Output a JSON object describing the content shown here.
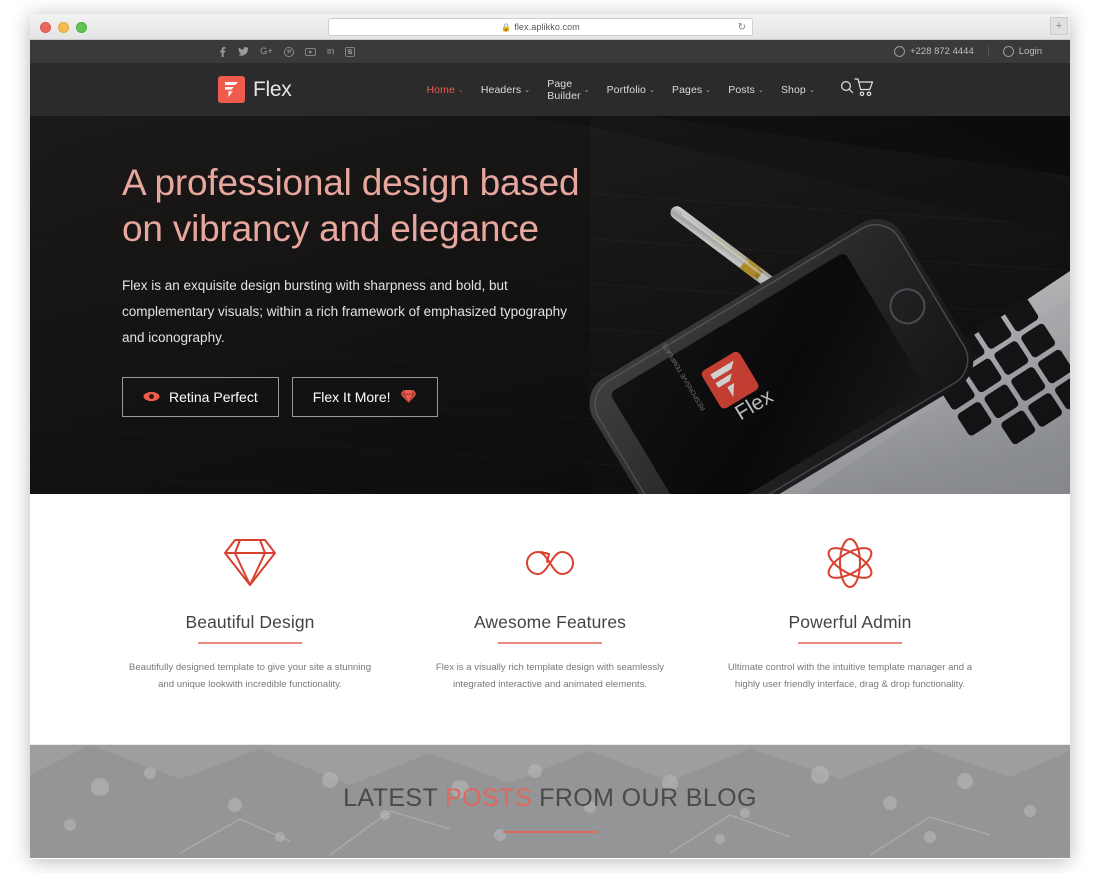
{
  "browser": {
    "url": "flex.aplikko.com",
    "lock_icon": "lock-icon",
    "reload_icon": "reload-icon",
    "new_tab_label": "+",
    "traffic_lights": [
      "close-red",
      "minimize-yellow",
      "maximize-green"
    ]
  },
  "topbar": {
    "social": [
      {
        "name": "facebook-icon",
        "glyph": "f"
      },
      {
        "name": "twitter-icon",
        "glyph": "t"
      },
      {
        "name": "google-plus-icon",
        "glyph": "G+"
      },
      {
        "name": "pinterest-icon",
        "glyph": "p"
      },
      {
        "name": "youtube-icon",
        "glyph": "yt"
      },
      {
        "name": "linkedin-icon",
        "glyph": "in"
      },
      {
        "name": "skype-icon",
        "glyph": "s"
      }
    ],
    "phone": "+228 872 4444",
    "login_label": "Login"
  },
  "nav": {
    "logo_text": "Flex",
    "items": [
      {
        "label": "Home",
        "caret": true,
        "active": true
      },
      {
        "label": "Headers",
        "caret": true,
        "active": false
      },
      {
        "label": "Page Builder",
        "caret": true,
        "active": false
      },
      {
        "label": "Portfolio",
        "caret": true,
        "active": false
      },
      {
        "label": "Pages",
        "caret": true,
        "active": false
      },
      {
        "label": "Posts",
        "caret": true,
        "active": false
      },
      {
        "label": "Shop",
        "caret": true,
        "active": false
      }
    ],
    "search_icon": "search-icon",
    "cart_icon": "shopping-cart-icon",
    "caret_glyph": "⌄"
  },
  "hero": {
    "title_line1": "A professional design based",
    "title_line2": "on vibrancy and elegance",
    "subtitle": "Flex is an exquisite design bursting with sharpness and bold, but complementary visuals; within a rich framework of emphasized typography and iconography.",
    "buttons": [
      {
        "label": "Retina Perfect",
        "icon": "eye-icon",
        "icon_side": "left"
      },
      {
        "label": "Flex It More!",
        "icon": "diamond-icon",
        "icon_side": "right"
      }
    ],
    "carousel": {
      "total": 5,
      "active_index": 0
    },
    "accent_color": "#e8a79e"
  },
  "features": [
    {
      "icon": "diamond-icon",
      "title": "Beautiful Design",
      "description": "Beautifully designed template to give your site a stunning and unique lookwith incredible functionality."
    },
    {
      "icon": "infinity-arrow-icon",
      "title": "Awesome Features",
      "description": "Flex is a visually rich template design with seamlessly integrated interactive and animated elements."
    },
    {
      "icon": "atom-icon",
      "title": "Powerful Admin",
      "description": "Ultimate control with the intuitive template manager and a highly user friendly interface, drag & drop functionality."
    }
  ],
  "blog": {
    "title_before": "LATEST ",
    "title_highlight": "POSTS",
    "title_after": " FROM OUR BLOG"
  },
  "colors": {
    "brand_red": "#ef5b4c",
    "accent_salmon": "#e8a79e",
    "nav_bg": "#2b2b2b",
    "topbar_bg": "#3a3a3a"
  }
}
